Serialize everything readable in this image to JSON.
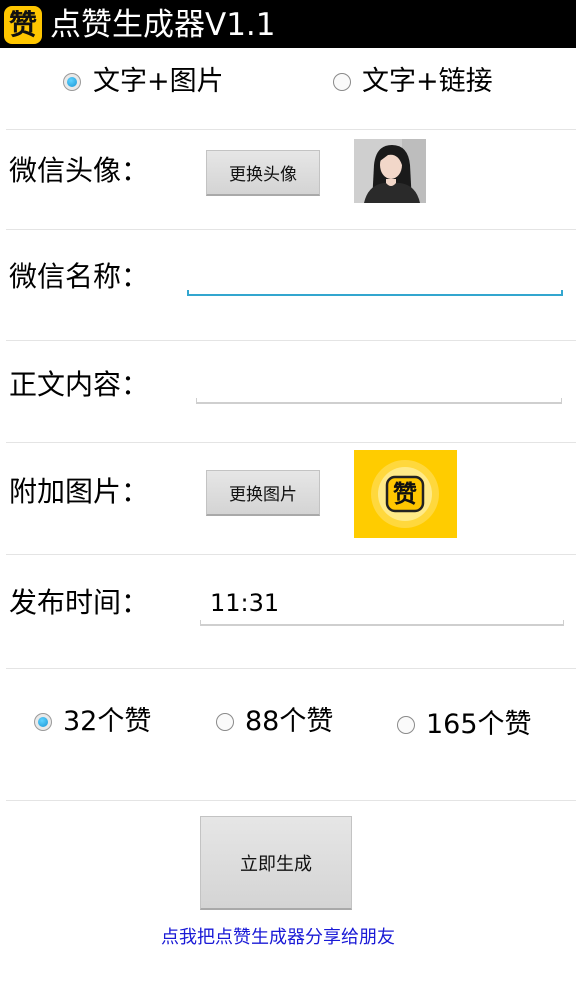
{
  "app": {
    "icon_char": "赞",
    "title": "点赞生成器V1.1"
  },
  "mode_options": [
    {
      "label": "文字+图片",
      "checked": true
    },
    {
      "label": "文字+链接",
      "checked": false
    }
  ],
  "rows": {
    "avatar": {
      "label": "微信头像：",
      "button": "更换头像"
    },
    "name": {
      "label": "微信名称：",
      "value": ""
    },
    "content": {
      "label": "正文内容：",
      "value": ""
    },
    "image": {
      "label": "附加图片：",
      "button": "更换图片",
      "image_char": "赞"
    },
    "time": {
      "label": "发布时间：",
      "value": "11:31"
    }
  },
  "like_options": [
    {
      "label": "32个赞",
      "checked": true
    },
    {
      "label": "88个赞",
      "checked": false
    },
    {
      "label": "165个赞",
      "checked": false
    }
  ],
  "generate_button": "立即生成",
  "share_link": "点我把点赞生成器分享给朋友",
  "colors": {
    "titlebar": "#000000",
    "accent": "#33a6cf",
    "icon_bg": "#ffc600",
    "link": "#1a1ad6"
  }
}
